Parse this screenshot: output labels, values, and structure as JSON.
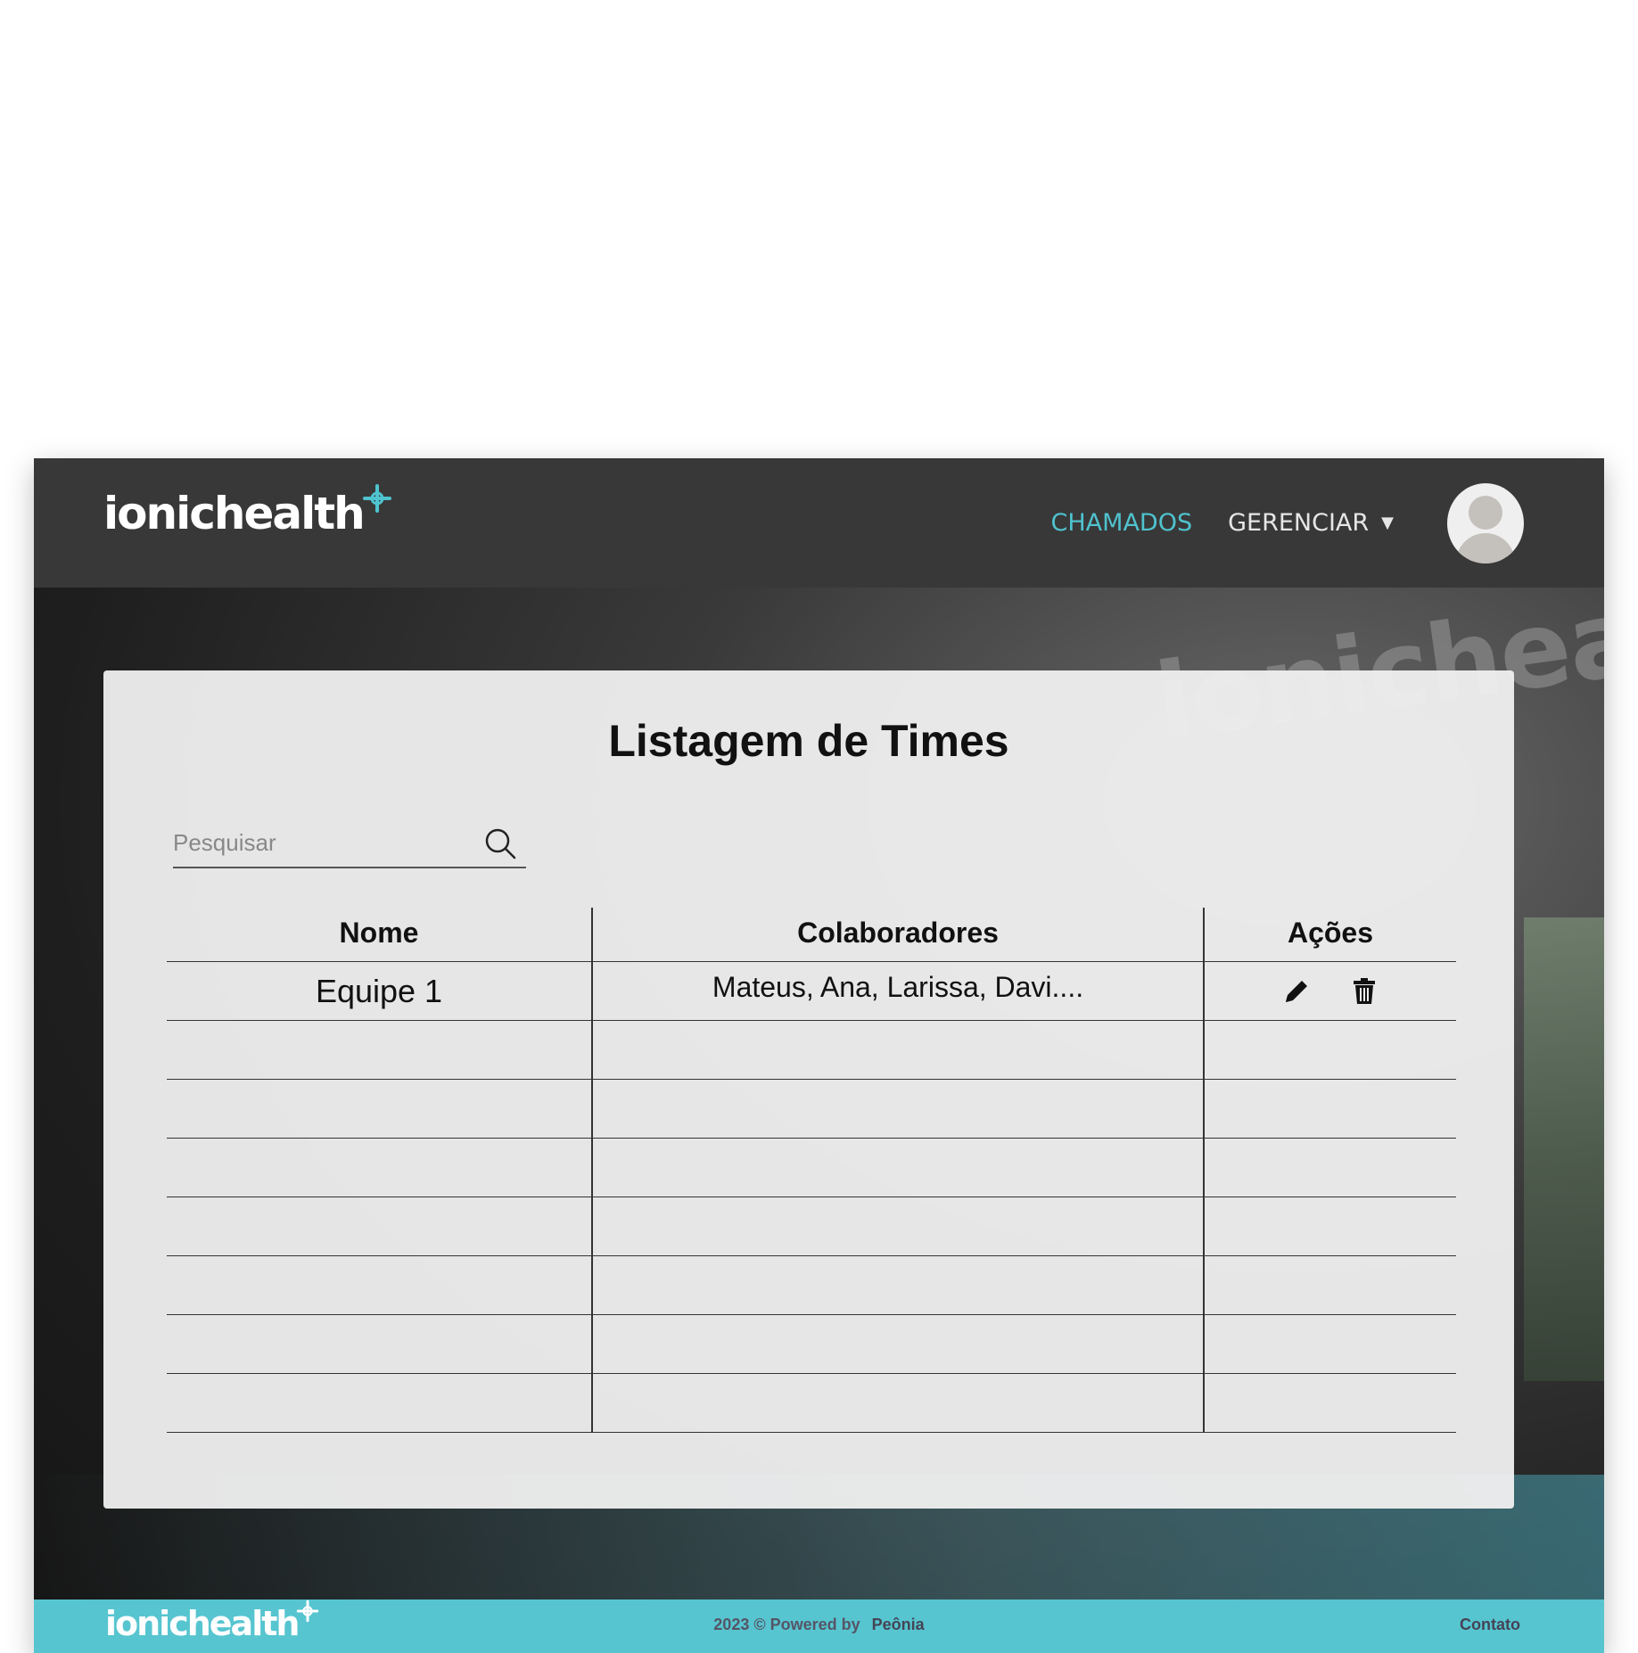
{
  "header": {
    "logo_text": "ionichealth",
    "nav": [
      {
        "label": "CHAMADOS",
        "active": true
      },
      {
        "label": "GERENCIAR",
        "active": false
      }
    ],
    "dropdown_icon": "caret-down-icon",
    "avatar_icon": "user-avatar-icon"
  },
  "background": {
    "logo_text": "ionichea"
  },
  "main": {
    "title": "Listagem de Times",
    "search": {
      "placeholder": "Pesquisar",
      "value": "",
      "icon": "search-icon"
    },
    "table": {
      "columns": [
        "Nome",
        "Colaboradores",
        "Ações"
      ],
      "rows": [
        {
          "nome": "Equipe 1",
          "colaboradores": "Mateus, Ana, Larissa, Davi....",
          "actions": [
            "edit-pencil-icon",
            "trash-icon"
          ]
        },
        {
          "nome": "",
          "colaboradores": ""
        },
        {
          "nome": "",
          "colaboradores": ""
        },
        {
          "nome": "",
          "colaboradores": ""
        },
        {
          "nome": "",
          "colaboradores": ""
        },
        {
          "nome": "",
          "colaboradores": ""
        },
        {
          "nome": "",
          "colaboradores": ""
        },
        {
          "nome": "",
          "colaboradores": ""
        }
      ]
    }
  },
  "footer": {
    "logo_text": "ionichealth",
    "copyright": "2023 © Powered by",
    "brand": "Peônia",
    "contact": "Contato"
  },
  "colors": {
    "accent": "#4fc3cf",
    "header_bg": "#383838",
    "footer_bg": "#56c5d0",
    "card_bg": "#f0f0f0"
  }
}
